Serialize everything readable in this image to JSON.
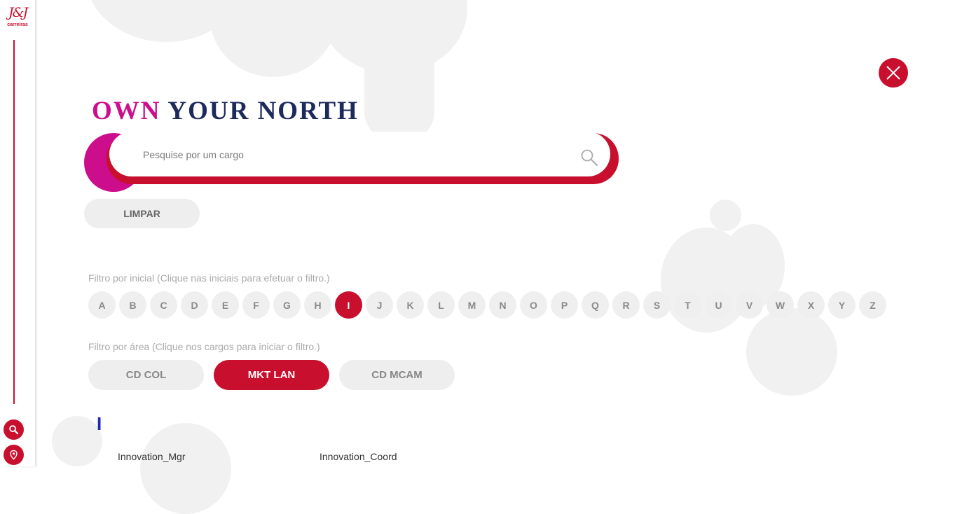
{
  "brand": {
    "logo_mark": "J&J",
    "logo_text": "carreiras",
    "accent_color": "#c8102e",
    "magenta_color": "#cc0d8c",
    "navy_color": "#1d2a5c"
  },
  "sidebar": {
    "buttons": [
      {
        "icon": "search-icon"
      },
      {
        "icon": "location-pin-icon"
      }
    ]
  },
  "headline": {
    "accent": "OWN",
    "rest": " YOUR NORTH"
  },
  "search": {
    "placeholder": "Pesquise por um cargo",
    "value": ""
  },
  "clear_label": "LIMPAR",
  "letter_filter": {
    "label": "Filtro por inicial (Clique nas iniciais para efetuar o filtro.)",
    "letters": [
      "A",
      "B",
      "C",
      "D",
      "E",
      "F",
      "G",
      "H",
      "I",
      "J",
      "K",
      "L",
      "M",
      "N",
      "O",
      "P",
      "Q",
      "R",
      "S",
      "T",
      "U",
      "V",
      "W",
      "X",
      "Y",
      "Z"
    ],
    "active": "I"
  },
  "area_filter": {
    "label": "Filtro por área (Clique nos cargos para iniciar o filtro.)",
    "areas": [
      "CD COL",
      "MKT LAN",
      "CD MCAM"
    ],
    "active": "MKT LAN"
  },
  "results": {
    "section_letter": "I",
    "jobs": [
      "Innovation_Mgr",
      "Innovation_Coord"
    ]
  }
}
